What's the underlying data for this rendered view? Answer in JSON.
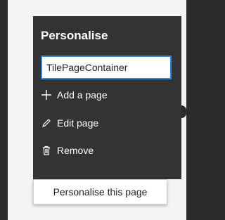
{
  "panel": {
    "title": "Personalise",
    "input": {
      "value": "TilePageContainer",
      "placeholder": ""
    },
    "items": [
      {
        "label": "Add a page",
        "icon": "plus-icon"
      },
      {
        "label": "Edit page",
        "icon": "pencil-icon"
      },
      {
        "label": "Remove",
        "icon": "trash-icon"
      }
    ]
  },
  "tooltip": {
    "label": "Personalise this page"
  },
  "colors": {
    "panel_bg": "#333333",
    "accent": "#2e86de",
    "page_bg": "#f4f4f4"
  }
}
